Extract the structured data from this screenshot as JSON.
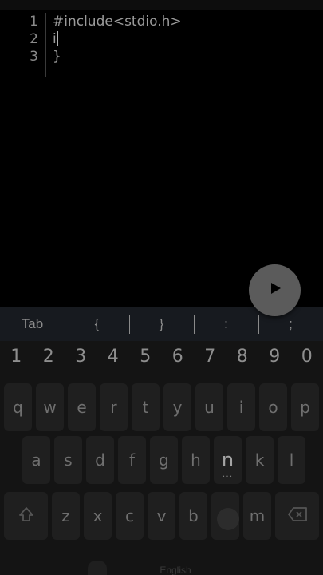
{
  "editor": {
    "line_numbers": [
      "1",
      "2",
      "3"
    ],
    "lines": [
      "#include<stdio.h>",
      "i",
      "}"
    ]
  },
  "run_button": {
    "icon": "play-icon"
  },
  "symbol_bar": [
    "Tab",
    "{",
    "}",
    ":",
    ";"
  ],
  "keyboard": {
    "digits": [
      "1",
      "2",
      "3",
      "4",
      "5",
      "6",
      "7",
      "8",
      "9",
      "0"
    ],
    "row_q": [
      "q",
      "w",
      "e",
      "r",
      "t",
      "y",
      "u",
      "i",
      "o",
      "p"
    ],
    "row_a": [
      "a",
      "s",
      "d",
      "f",
      "g",
      "h",
      "n",
      "k",
      "l"
    ],
    "row_z": [
      "z",
      "x",
      "c",
      "v",
      "b",
      "n",
      "m"
    ],
    "shift_icon": "shift-icon",
    "backspace_icon": "backspace-icon",
    "space_label": "English"
  },
  "colors": {
    "background": "#000000",
    "symbol_bar": "#171a1f",
    "keyboard": "#141414",
    "run_button": "#5b5b5b"
  }
}
